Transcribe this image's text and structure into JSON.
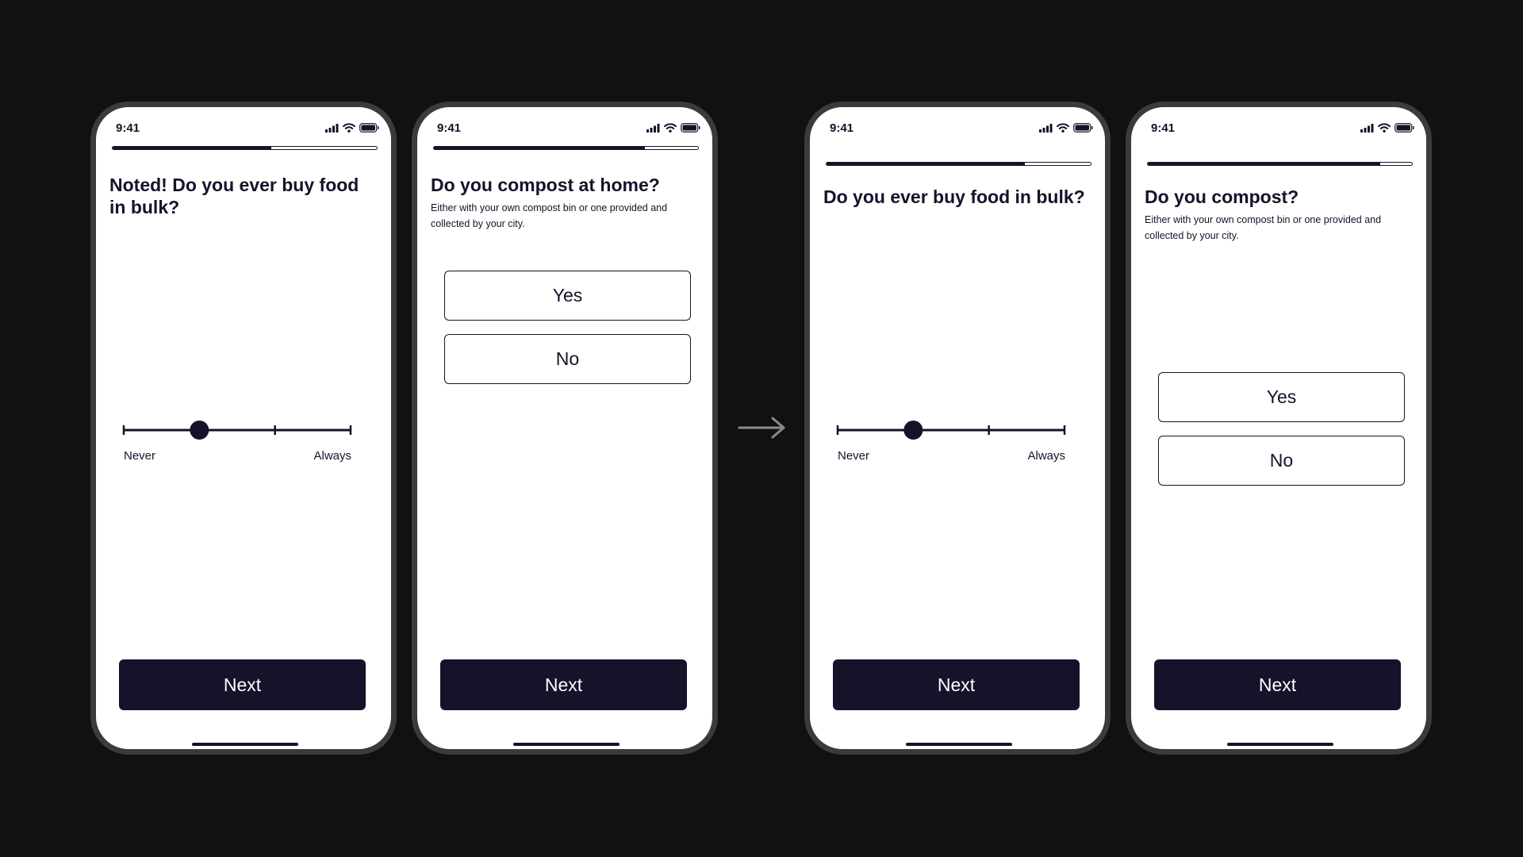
{
  "colors": {
    "background": "#111111",
    "frame": "#3b3b3b",
    "ink": "#15132a",
    "surface": "#ffffff",
    "arrow": "#8a8a8a"
  },
  "phones": [
    {
      "status_time": "9:41",
      "progress": 0.6,
      "question": "Noted! Do you ever buy food in bulk?",
      "slider": {
        "min_label": "Never",
        "max_label": "Always",
        "steps": 4,
        "selected_step": 1
      },
      "next_label": "Next"
    },
    {
      "status_time": "9:41",
      "progress": 0.8,
      "question": "Do you compost at home?",
      "subtitle": "Either with your own compost bin or one provided and collected by your city.",
      "options": [
        "Yes",
        "No"
      ],
      "next_label": "Next"
    },
    {
      "status_time": "9:41",
      "progress": 0.75,
      "question": "Do you ever buy food in bulk?",
      "slider": {
        "min_label": "Never",
        "max_label": "Always",
        "steps": 4,
        "selected_step": 1
      },
      "next_label": "Next"
    },
    {
      "status_time": "9:41",
      "progress": 0.88,
      "question": "Do you compost?",
      "subtitle": "Either with your own compost bin or one provided and collected by your city.",
      "options": [
        "Yes",
        "No"
      ],
      "next_label": "Next"
    }
  ],
  "icons": [
    "cellular-signal-icon",
    "wifi-icon",
    "battery-icon",
    "arrow-right-icon"
  ]
}
